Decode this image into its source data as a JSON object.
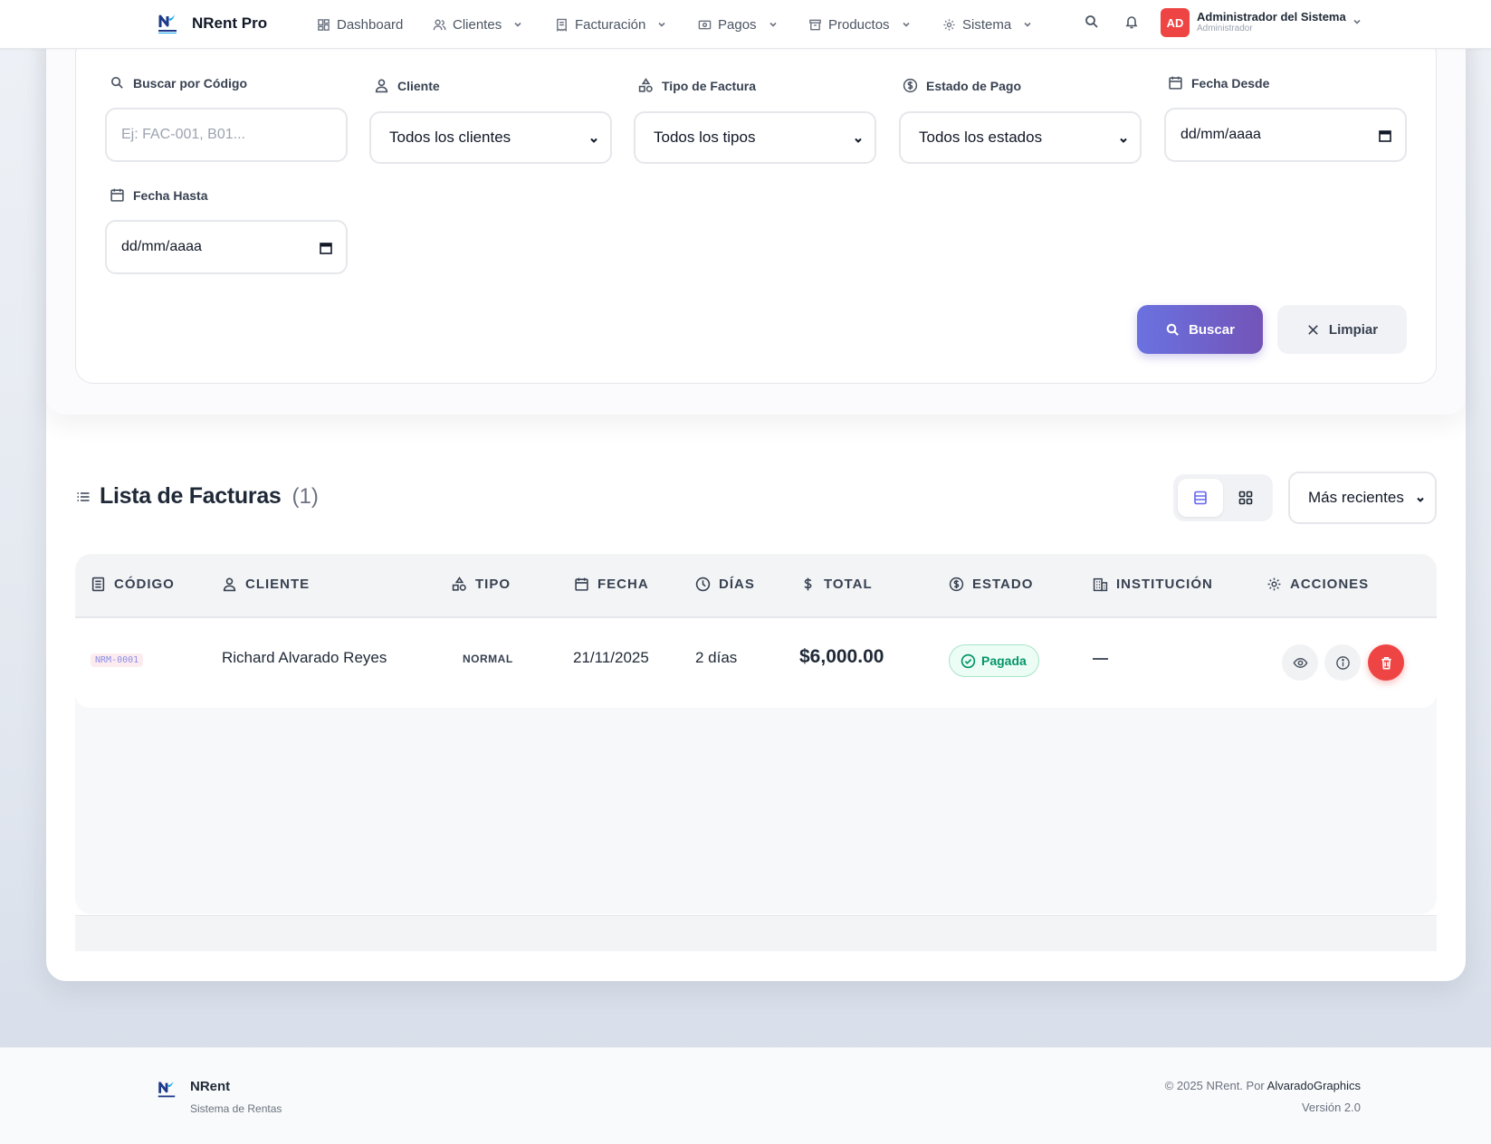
{
  "app": {
    "name": "NRent Pro"
  },
  "nav": {
    "items": [
      {
        "label": "Dashboard",
        "icon": "dashboard-icon",
        "dropdown": false
      },
      {
        "label": "Clientes",
        "icon": "users-icon",
        "dropdown": true
      },
      {
        "label": "Facturación",
        "icon": "receipt-icon",
        "dropdown": true
      },
      {
        "label": "Pagos",
        "icon": "cash-icon",
        "dropdown": true
      },
      {
        "label": "Productos",
        "icon": "box-icon",
        "dropdown": true
      },
      {
        "label": "Sistema",
        "icon": "gear-icon",
        "dropdown": true
      }
    ]
  },
  "user": {
    "initials": "AD",
    "name": "Administrador del Sistema",
    "role": "Administrador",
    "avatar_color": "#ef4444"
  },
  "filters": {
    "codigo": {
      "label": "Buscar por Código",
      "placeholder": "Ej: FAC-001, B01..."
    },
    "cliente": {
      "label": "Cliente",
      "value": "Todos los clientes"
    },
    "tipo": {
      "label": "Tipo de Factura",
      "value": "Todos los tipos"
    },
    "estado": {
      "label": "Estado de Pago",
      "value": "Todos los estados"
    },
    "fecha_desde": {
      "label": "Fecha Desde",
      "value": "dd/mm/aaaa"
    },
    "fecha_hasta": {
      "label": "Fecha Hasta",
      "value": "dd/mm/aaaa"
    },
    "buscar_label": "Buscar",
    "limpiar_label": "Limpiar"
  },
  "list": {
    "title": "Lista de Facturas",
    "count": "(1)",
    "sort": "Más recientes",
    "columns": [
      "CÓDIGO",
      "CLIENTE",
      "TIPO",
      "FECHA",
      "DÍAS",
      "TOTAL",
      "ESTADO",
      "INSTITUCIÓN",
      "ACCIONES"
    ],
    "rows": [
      {
        "codigo": "NRM-0001",
        "cliente": "Richard Alvarado Reyes",
        "tipo": "NORMAL",
        "fecha": "21/11/2025",
        "dias": "2 días",
        "total": "$6,000.00",
        "estado": "Pagada",
        "institucion": "—"
      }
    ]
  },
  "footer": {
    "name": "NRent",
    "subtitle": "Sistema de Rentas",
    "copyright": "© 2025 NRent. Por",
    "author": "AlvaradoGraphics",
    "version": "Versión 2.0"
  },
  "colors": {
    "accent": "#6366f1",
    "button_gradient_start": "#6a72e0",
    "button_gradient_end": "#7354b8",
    "success": "#059669",
    "danger": "#ef4444"
  }
}
